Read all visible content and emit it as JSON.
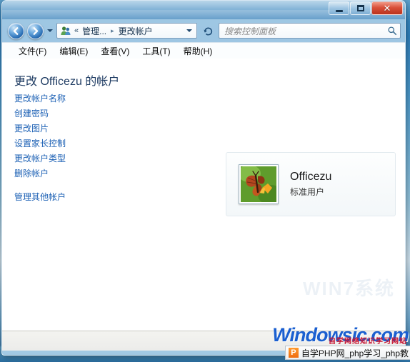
{
  "window": {
    "controls": {
      "minimize_label": "–",
      "maximize_label": "□",
      "close_label": "✕"
    }
  },
  "navbar": {
    "back_name": "back-button",
    "forward_name": "forward-button",
    "history_caret": "▼",
    "breadcrumb": {
      "chevrons": "«",
      "items": [
        "管理...",
        "更改帐户"
      ],
      "separator": "▸",
      "dropdown_caret": "▼"
    },
    "refresh_label": "↻",
    "search": {
      "placeholder": "搜索控制面板",
      "icon": "search-icon"
    }
  },
  "menubar": {
    "items": [
      {
        "label": "文件(F)"
      },
      {
        "label": "编辑(E)"
      },
      {
        "label": "查看(V)"
      },
      {
        "label": "工具(T)"
      },
      {
        "label": "帮助(H)"
      }
    ]
  },
  "content": {
    "page_title": "更改 Officezu 的帐户",
    "task_links": [
      {
        "label": "更改帐户名称",
        "spaced": false
      },
      {
        "label": "创建密码",
        "spaced": false
      },
      {
        "label": "更改图片",
        "spaced": false
      },
      {
        "label": "设置家长控制",
        "spaced": false
      },
      {
        "label": "更改帐户类型",
        "spaced": false
      },
      {
        "label": "删除帐户",
        "spaced": false
      },
      {
        "label": "管理其他帐户",
        "spaced": true
      }
    ],
    "user_card": {
      "name": "Officezu",
      "type": "标准用户",
      "avatar_icon": "butterfly-avatar-icon"
    },
    "faint_watermark": "WIN7系统"
  },
  "watermarks": {
    "site": "Windowsic.com",
    "site_cn": "自学网络知识学习网站",
    "taskbar_icon_letter": "P",
    "taskbar_text": "自学PHP网_php学习_php教"
  },
  "colors": {
    "link": "#1a5fb4",
    "title": "#1f3c63",
    "close_button": "#d9503a",
    "watermark_blue": "#1a5fd0",
    "watermark_red": "#c8102e"
  }
}
